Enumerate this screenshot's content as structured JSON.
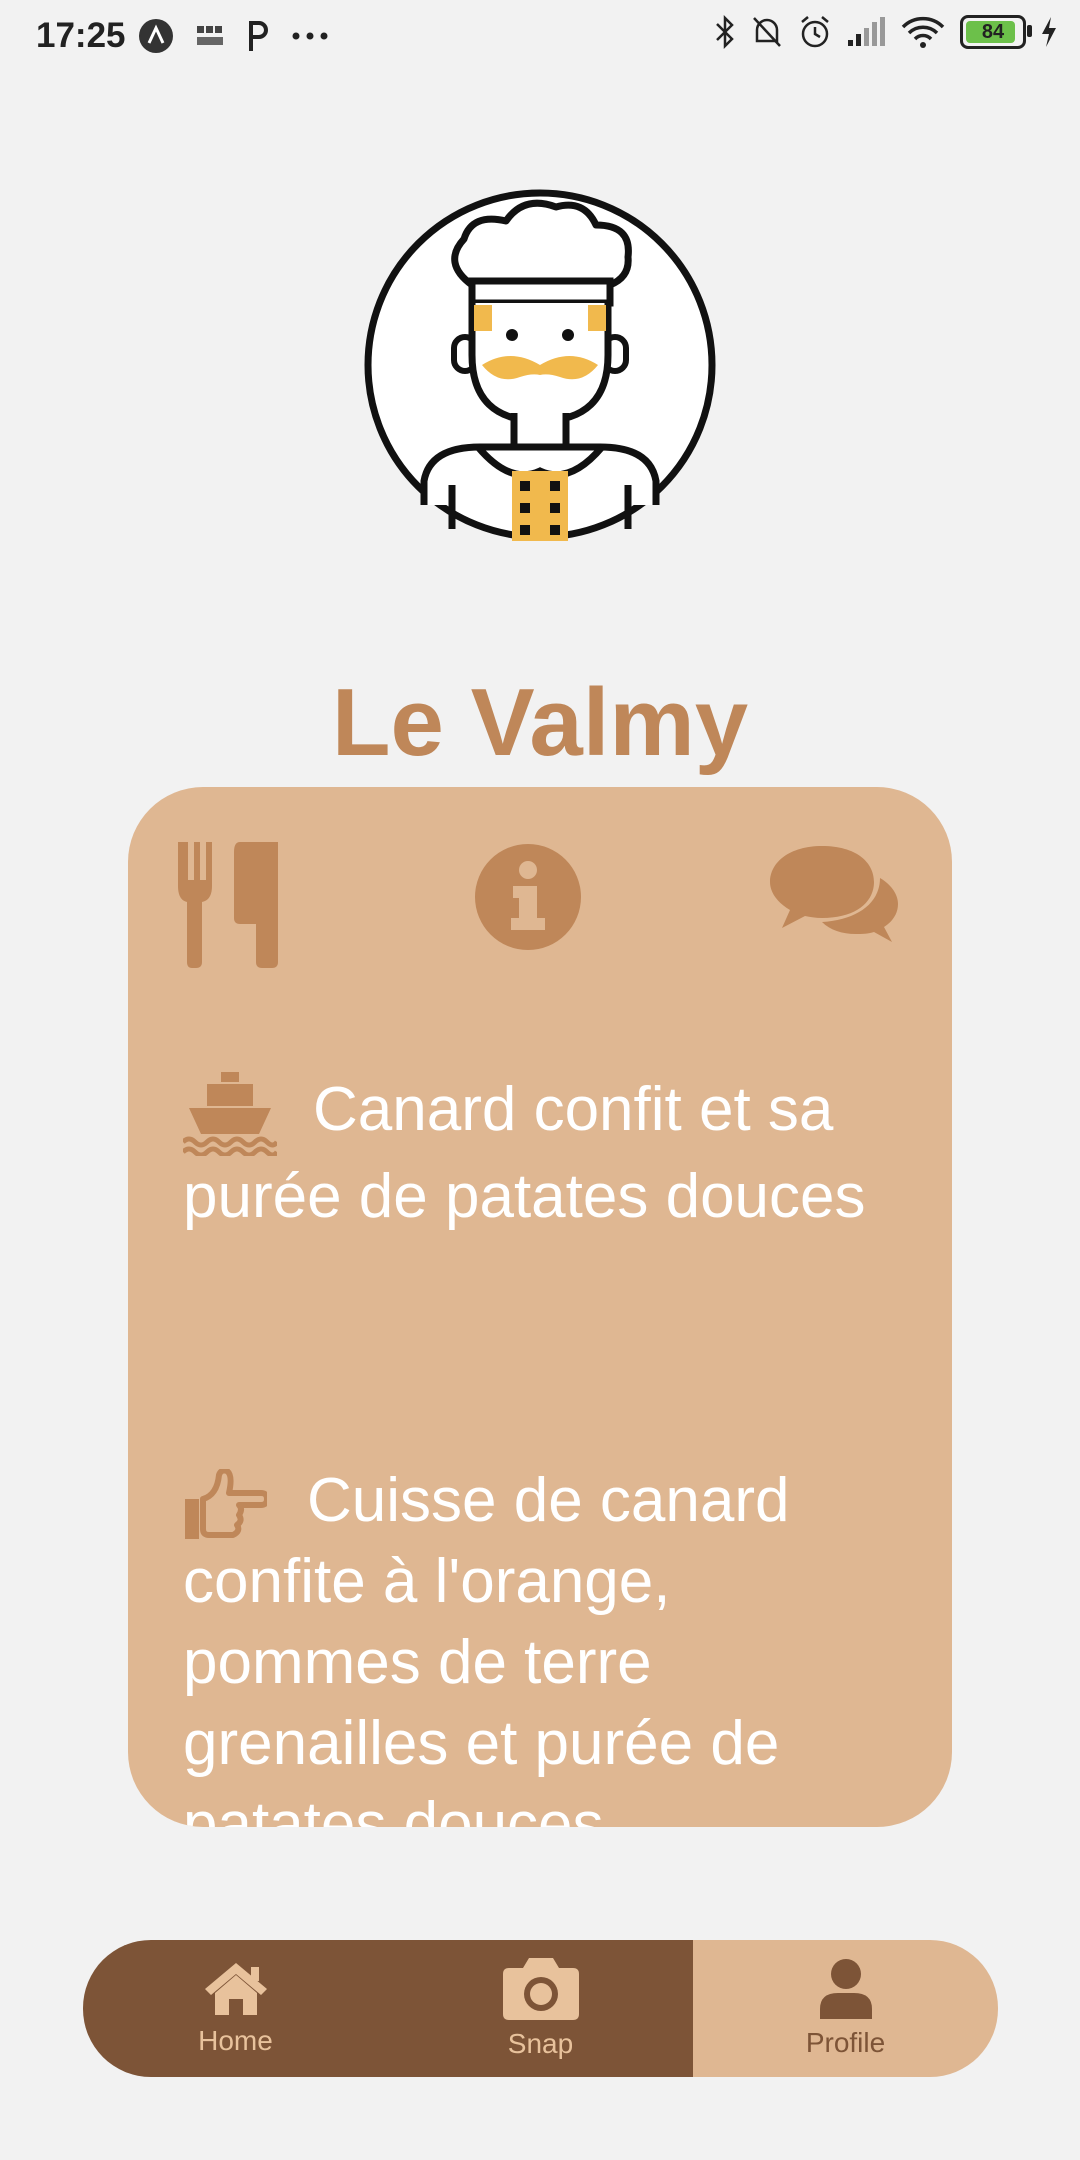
{
  "status_bar": {
    "time": "17:25",
    "battery": "84",
    "icons": [
      "app-icon",
      "bbc-news-icon",
      "p-icon",
      "more-icon",
      "bluetooth-icon",
      "mute-icon",
      "alarm-icon",
      "signal-icon",
      "wifi-icon",
      "battery-icon",
      "charging-icon"
    ]
  },
  "restaurant": {
    "name": "Le Valmy",
    "avatar": "chef-avatar"
  },
  "card": {
    "tabs": [
      {
        "icon": "utensils-icon"
      },
      {
        "icon": "info-icon"
      },
      {
        "icon": "comments-icon"
      }
    ],
    "dishes": [
      {
        "icon": "ship-icon",
        "text": "Canard confit et sa purée de patates douces"
      },
      {
        "icon": "hand-point-right-icon",
        "text": "Cuisse de canard confite à l'orange, pommes de terre grenailles et purée de patates douces"
      }
    ]
  },
  "nav": {
    "items": [
      {
        "label": "Home",
        "icon": "home-icon"
      },
      {
        "label": "Snap",
        "icon": "camera-icon"
      },
      {
        "label": "Profile",
        "icon": "user-icon"
      }
    ],
    "active": "Profile"
  },
  "colors": {
    "background": "#f2f2f2",
    "accent": "#bf8759",
    "card": "#dfb792",
    "nav_dark": "#7d5437"
  }
}
